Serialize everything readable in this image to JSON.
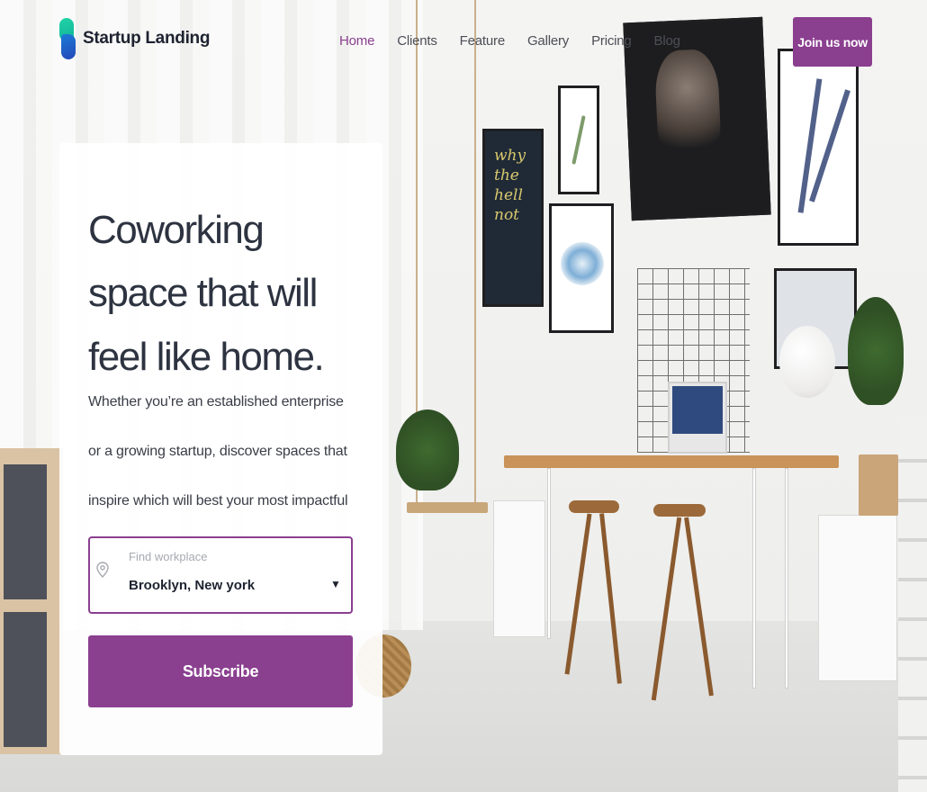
{
  "brand": {
    "name": "Startup Landing",
    "accent": "#8a3f8f",
    "logo_colors": [
      "#22d3a6",
      "#2348b8"
    ]
  },
  "nav": {
    "items": [
      {
        "label": "Home",
        "active": true
      },
      {
        "label": "Clients",
        "active": false
      },
      {
        "label": "Feature",
        "active": false
      },
      {
        "label": "Gallery",
        "active": false
      },
      {
        "label": "Pricing",
        "active": false
      },
      {
        "label": "Blog",
        "active": false
      }
    ],
    "cta_label": "Join us now"
  },
  "hero": {
    "title": "Coworking space that will feel like home.",
    "description": "Whether you’re an established enterprise or a growing startup, discover spaces that inspire which will best your most impactful work.",
    "location_field": {
      "label": "Find workplace",
      "selected_value": "Brooklyn, New york",
      "icon": "map-pin-icon"
    },
    "submit_label": "Subscribe"
  },
  "background": {
    "artwork_text": "why the hell not"
  }
}
